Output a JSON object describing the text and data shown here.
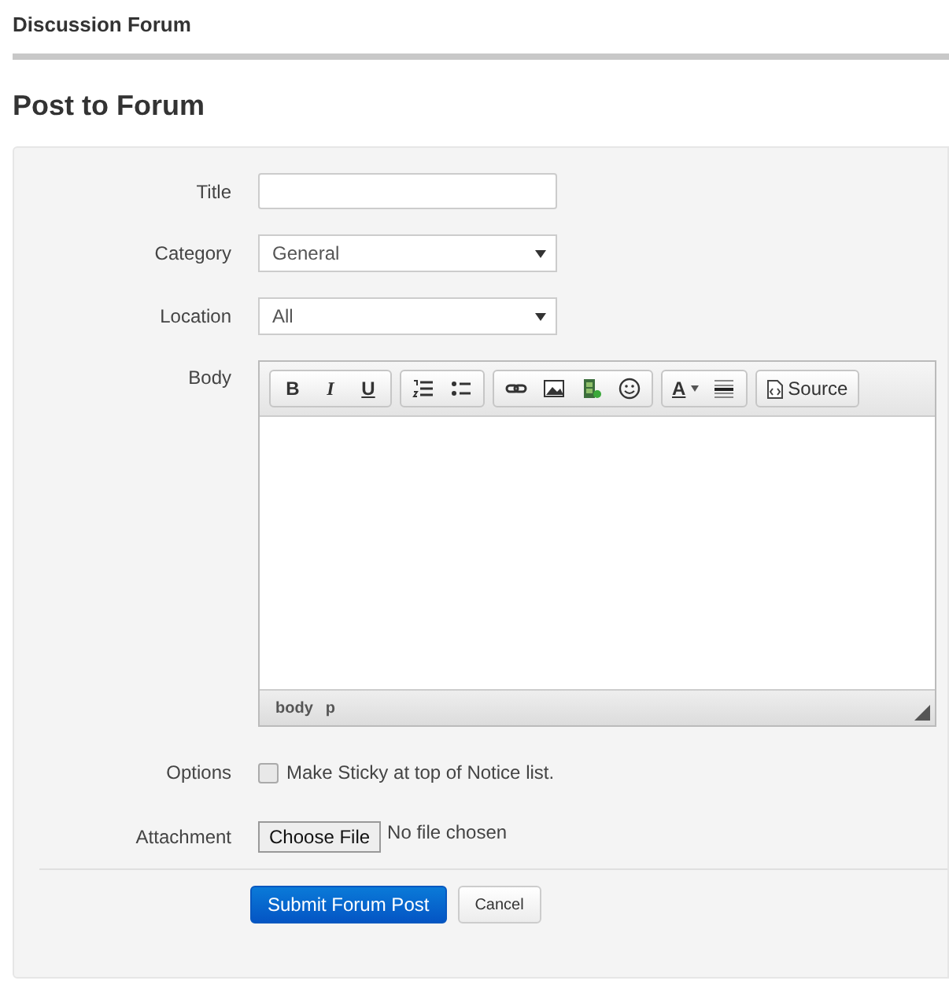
{
  "header": {
    "title": "Discussion Forum"
  },
  "page_title": "Post to Forum",
  "form": {
    "title": {
      "label": "Title"
    },
    "category": {
      "label": "Category",
      "value": "General"
    },
    "location": {
      "label": "Location",
      "value": "All"
    },
    "body": {
      "label": "Body",
      "toolbar": [
        {
          "buttons": [
            {
              "kind": "text",
              "label": "B"
            },
            {
              "kind": "text",
              "label": "I"
            },
            {
              "kind": "text",
              "label": "U"
            }
          ]
        },
        {
          "buttons": [
            {
              "kind": "icon"
            },
            {
              "kind": "icon"
            }
          ]
        },
        {
          "buttons": [
            {
              "kind": "icon"
            },
            {
              "kind": "icon"
            },
            {
              "kind": "icon"
            },
            {
              "kind": "icon"
            }
          ]
        },
        {
          "buttons": [
            {
              "kind": "color",
              "label": "A"
            },
            {
              "kind": "icon"
            }
          ]
        },
        {
          "buttons": [
            {
              "kind": "labeled",
              "label": "Source"
            }
          ]
        }
      ],
      "path": [
        "body",
        "p"
      ]
    },
    "options": {
      "label": "Options",
      "checkbox": {
        "label": "Make Sticky at top of Notice list.",
        "checked": false
      }
    },
    "attachment": {
      "label": "Attachment",
      "button": "Choose File",
      "status": "No file chosen"
    },
    "buttons": [
      {
        "kind": "primary",
        "label": "Submit Forum Post"
      },
      {
        "kind": "default",
        "label": "Cancel"
      }
    ]
  }
}
